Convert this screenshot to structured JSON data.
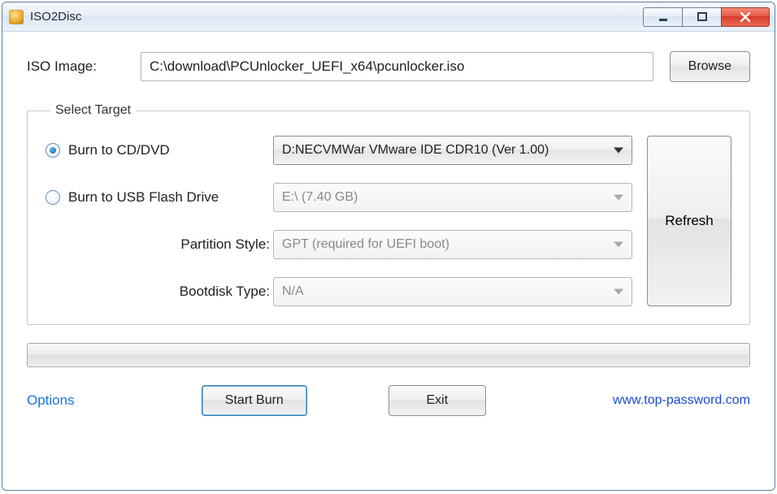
{
  "window": {
    "title": "ISO2Disc"
  },
  "iso": {
    "label": "ISO Image:",
    "path": "C:\\download\\PCUnlocker_UEFI_x64\\pcunlocker.iso",
    "browse": "Browse"
  },
  "target": {
    "legend": "Select Target",
    "cd_label": "Burn to CD/DVD",
    "cd_drive": "D:NECVMWar VMware IDE CDR10 (Ver 1.00)",
    "usb_label": "Burn to USB Flash Drive",
    "usb_drive": "E:\\ (7.40 GB)",
    "partition_label": "Partition Style:",
    "partition_value": "GPT (required for UEFI boot)",
    "bootdisk_label": "Bootdisk Type:",
    "bootdisk_value": "N/A",
    "refresh": "Refresh"
  },
  "footer": {
    "options": "Options",
    "start": "Start Burn",
    "exit": "Exit",
    "url": "www.top-password.com"
  }
}
